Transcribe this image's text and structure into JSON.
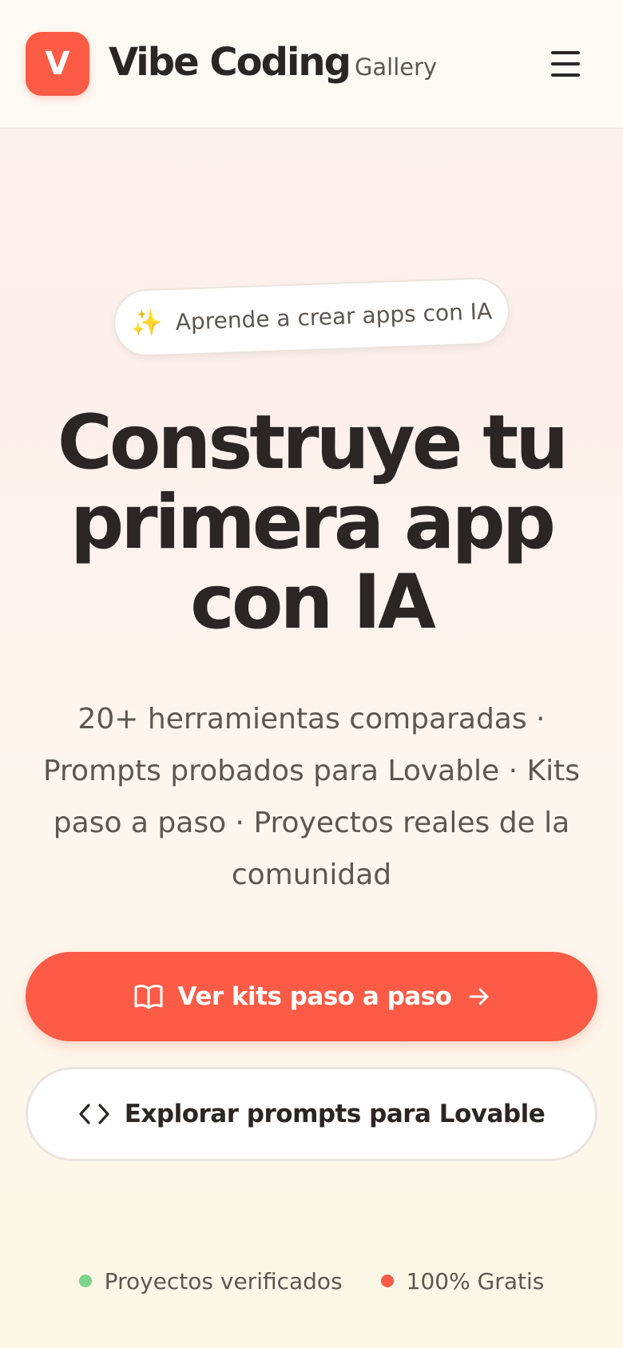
{
  "header": {
    "logo_letter": "V",
    "brand_name": "Vibe Coding",
    "brand_sub": "Gallery"
  },
  "hero": {
    "badge_icon": "sparkles-icon",
    "badge_text": "Aprende a crear apps con IA",
    "headline_lines": [
      "Construye tu",
      "primera app",
      "con IA"
    ],
    "subtitle": "20+ herramientas comparadas · Prompts probados para Lovable · Kits paso a paso · Proyectos reales de la comunidad"
  },
  "actions": {
    "primary": {
      "label": "Ver kits paso a paso",
      "icon": "book-icon",
      "trailing_icon": "arrow-right-icon"
    },
    "secondary": {
      "label": "Explorar prompts para Lovable",
      "icon": "code-icon"
    }
  },
  "stats": [
    {
      "label": "Proyectos verificados",
      "color": "#7bd48b"
    },
    {
      "label": "100% Gratis",
      "color": "#fc5b46"
    }
  ],
  "colors": {
    "brand": "#fc5b46",
    "text": "#2b2624",
    "muted": "#5d5651"
  }
}
